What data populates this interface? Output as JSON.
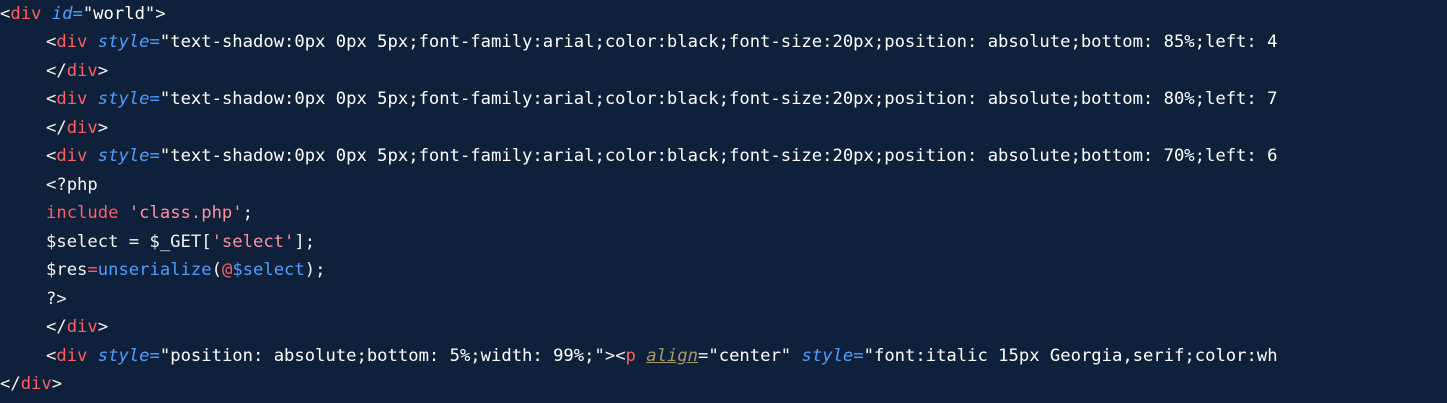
{
  "colors": {
    "background": "#0f213a",
    "tag": "#ff5f63",
    "attribute": "#4f9dff",
    "text": "#f3f3f3"
  },
  "lines": [
    {
      "t1": "<",
      "tag": "div",
      "sp": " ",
      "attr": "id",
      "eq": "=",
      "val": "\"world\"",
      "end": ">"
    },
    {
      "t1": "<",
      "tag": "div",
      "sp": " ",
      "attr": "style",
      "eq": "=",
      "val": "\"text-shadow:0px 0px 5px;font-family:arial;color:black;font-size:20px;position: absolute;bottom: 85%;left: 4"
    },
    {
      "t1": "</",
      "tag": "div",
      "end": ">"
    },
    {
      "t1": "<",
      "tag": "div",
      "sp": " ",
      "attr": "style",
      "eq": "=",
      "val": "\"text-shadow:0px 0px 5px;font-family:arial;color:black;font-size:20px;position: absolute;bottom: 80%;left: 7"
    },
    {
      "t1": "</",
      "tag": "div",
      "end": ">"
    },
    {
      "t1": "<",
      "tag": "div",
      "sp": " ",
      "attr": "style",
      "eq": "=",
      "val": "\"text-shadow:0px 0px 5px;font-family:arial;color:black;font-size:20px;position: absolute;bottom: 70%;left: 6"
    },
    {
      "php": "<?php"
    },
    {
      "kw": "include",
      "sp": " ",
      "str": "'class.php'",
      "end": ";"
    },
    {
      "a": "$select = $_GET[",
      "str": "'select'",
      "b": "];"
    },
    {
      "a": "$res",
      "eq": "=",
      "fn": "unserialize",
      "p1": "(",
      "at": "@",
      "pv": "$select",
      "p2": ");"
    },
    {
      "php": "?>"
    },
    {
      "t1": "</",
      "tag": "div",
      "end": ">"
    },
    {
      "t1": "<",
      "tag": "div",
      "sp": " ",
      "attr": "style",
      "eq": "=",
      "val": "\"position: absolute;bottom: 5%;width: 99%;\"",
      "end": "><",
      "tag2": "p",
      "sp2": " ",
      "align": "align",
      "eq2": "=",
      "val2": "\"center\"",
      "sp3": " ",
      "attr2": "style",
      "eq3": "=",
      "val3": "\"font:italic 15px Georgia,serif;color:wh"
    },
    {
      "t1": "</",
      "tag": "div",
      "end": ">"
    }
  ]
}
